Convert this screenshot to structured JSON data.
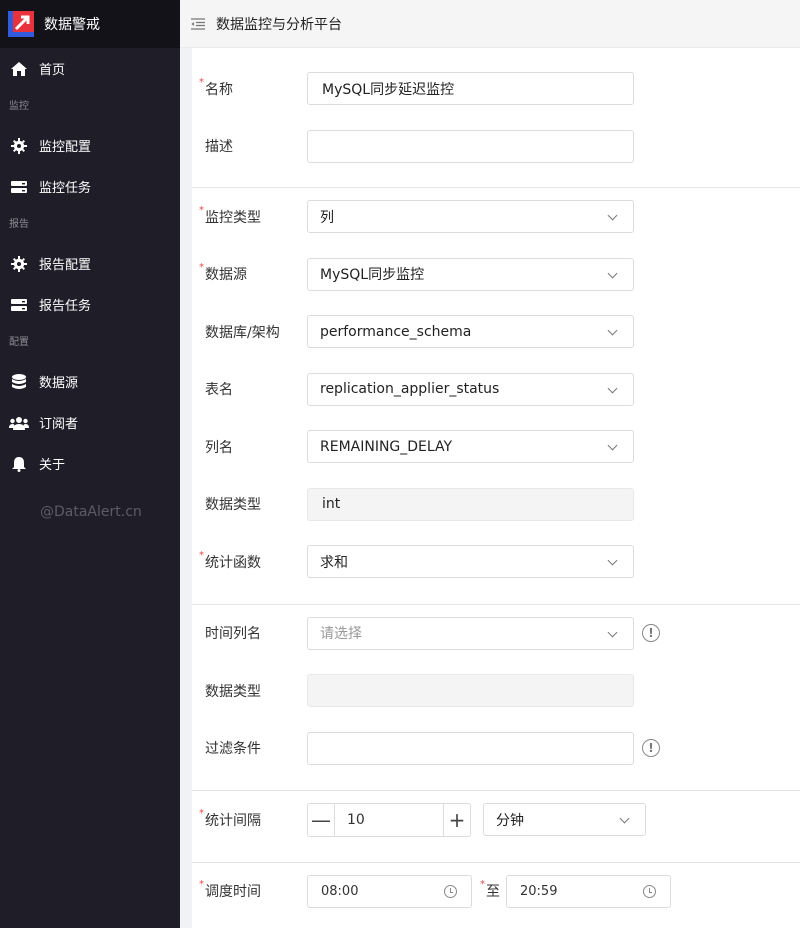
{
  "app": {
    "title": "数据警戒"
  },
  "header": {
    "title": "数据监控与分析平台"
  },
  "sidebar": {
    "home": "首页",
    "groups": [
      {
        "label": "监控",
        "items": [
          {
            "label": "监控配置",
            "icon": "gear-icon"
          },
          {
            "label": "监控任务",
            "icon": "server-icon"
          }
        ]
      },
      {
        "label": "报告",
        "items": [
          {
            "label": "报告配置",
            "icon": "gear-icon"
          },
          {
            "label": "报告任务",
            "icon": "server-icon"
          }
        ]
      },
      {
        "label": "配置",
        "items": [
          {
            "label": "数据源",
            "icon": "database-icon"
          },
          {
            "label": "订阅者",
            "icon": "users-icon"
          },
          {
            "label": "关于",
            "icon": "bell-icon"
          }
        ]
      }
    ],
    "watermark": "@DataAlert.cn"
  },
  "form": {
    "name": {
      "label": "名称",
      "value": "MySQL同步延迟监控"
    },
    "desc": {
      "label": "描述",
      "value": ""
    },
    "monitor_type": {
      "label": "监控类型",
      "value": "列"
    },
    "datasource": {
      "label": "数据源",
      "value": "MySQL同步监控"
    },
    "schema": {
      "label": "数据库/架构",
      "value": "performance_schema"
    },
    "table": {
      "label": "表名",
      "value": "replication_applier_status"
    },
    "column": {
      "label": "列名",
      "value": "REMAINING_DELAY"
    },
    "data_type": {
      "label": "数据类型",
      "value": "int"
    },
    "agg": {
      "label": "统计函数",
      "value": "求和"
    },
    "time_col": {
      "label": "时间列名",
      "placeholder": "请选择"
    },
    "time_data_type": {
      "label": "数据类型",
      "value": ""
    },
    "filter": {
      "label": "过滤条件",
      "value": ""
    },
    "interval": {
      "label": "统计间隔",
      "value": "10",
      "minus": "—",
      "plus": "+",
      "unit": "分钟"
    },
    "schedule": {
      "label": "调度时间",
      "start": "08:00",
      "to": "至",
      "end": "20:59"
    }
  },
  "colors": {
    "sidebar_bg": "#1f1d28",
    "required": "#e84a4a"
  }
}
